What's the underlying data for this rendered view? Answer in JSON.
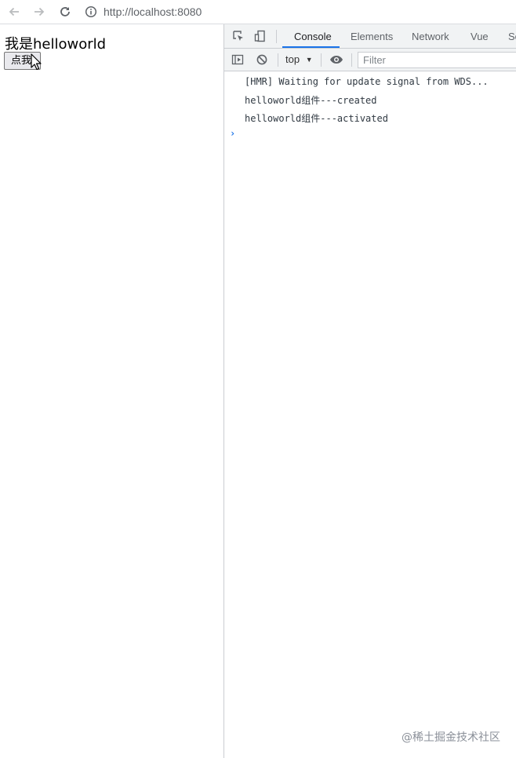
{
  "browser": {
    "url": "http://localhost:8080",
    "icons": {
      "back": "back-arrow-icon",
      "forward": "forward-arrow-icon",
      "reload": "reload-icon",
      "info": "info-icon"
    }
  },
  "page": {
    "title": "我是helloworld",
    "button_label": "点我"
  },
  "devtools": {
    "tabs": [
      {
        "label": "Console",
        "active": true
      },
      {
        "label": "Elements",
        "active": false
      },
      {
        "label": "Network",
        "active": false
      },
      {
        "label": "Vue",
        "active": false
      },
      {
        "label": "So",
        "active": false
      }
    ],
    "context": "top",
    "filter_placeholder": "Filter",
    "console_lines": [
      "[HMR] Waiting for update signal from WDS...",
      "helloworld组件---created",
      "helloworld组件---activated"
    ],
    "prompt_symbol": "›"
  },
  "watermark": "@稀土掘金技术社区",
  "colors": {
    "accent": "#1a73e8",
    "toolbar_bg": "#f1f3f4"
  }
}
